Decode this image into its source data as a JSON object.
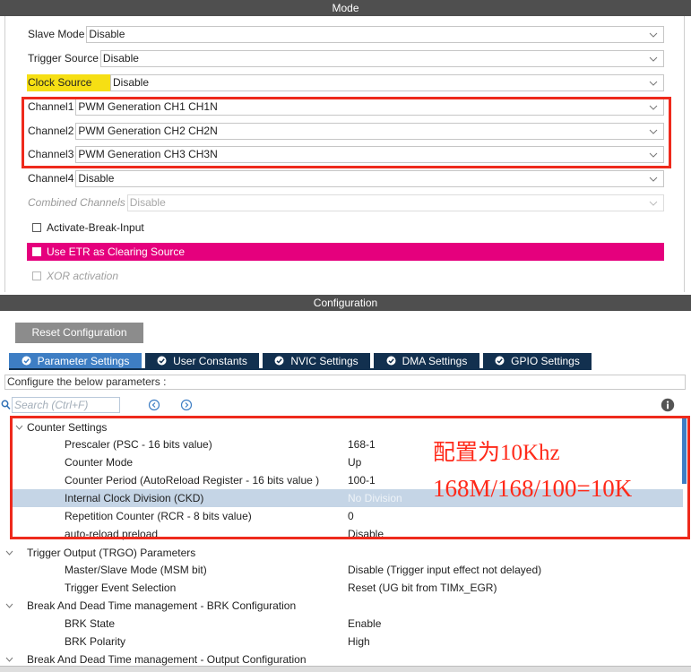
{
  "mode": {
    "header": "Mode",
    "slave_mode": {
      "label": "Slave Mode",
      "value": "Disable"
    },
    "trigger_source": {
      "label": "Trigger Source",
      "value": "Disable"
    },
    "clock_source": {
      "label": "Clock Source",
      "value": "Disable"
    },
    "channel1": {
      "label": "Channel1",
      "value": "PWM Generation CH1 CH1N"
    },
    "channel2": {
      "label": "Channel2",
      "value": "PWM Generation CH2 CH2N"
    },
    "channel3": {
      "label": "Channel3",
      "value": "PWM Generation CH3 CH3N"
    },
    "channel4": {
      "label": "Channel4",
      "value": "Disable"
    },
    "combined_channels": {
      "label": "Combined Channels",
      "value": "Disable",
      "disabled": true
    },
    "activate_break_input": {
      "label": "Activate-Break-Input",
      "checked": false
    },
    "use_etr": {
      "label": "Use ETR as Clearing Source",
      "checked": false
    },
    "xor_activation": {
      "label": "XOR activation",
      "checked": false,
      "disabled": true
    }
  },
  "configuration": {
    "header": "Configuration",
    "reset_button": "Reset Configuration",
    "tabs": [
      {
        "label": "Parameter Settings",
        "icon": "check-circle-icon",
        "active": true
      },
      {
        "label": "User Constants",
        "icon": "check-circle-icon",
        "active": false
      },
      {
        "label": "NVIC Settings",
        "icon": "check-circle-icon",
        "active": false
      },
      {
        "label": "DMA Settings",
        "icon": "check-circle-icon",
        "active": false
      },
      {
        "label": "GPIO Settings",
        "icon": "check-circle-icon",
        "active": false
      }
    ],
    "hint": "Configure the below parameters :",
    "search_placeholder": "Search (Ctrl+F)",
    "groups": [
      {
        "group": "Counter Settings",
        "params": [
          {
            "name": "Prescaler (PSC - 16 bits value)",
            "value": "168-1"
          },
          {
            "name": "Counter Mode",
            "value": "Up"
          },
          {
            "name": "Counter Period (AutoReload Register - 16 bits value )",
            "value": "100-1"
          },
          {
            "name": "Internal Clock Division (CKD)",
            "value": "No Division",
            "selected": true
          },
          {
            "name": "Repetition Counter (RCR - 8 bits value)",
            "value": "0"
          },
          {
            "name": "auto-reload preload",
            "value": "Disable"
          }
        ]
      },
      {
        "group": "Trigger Output (TRGO) Parameters",
        "params": [
          {
            "name": "Master/Slave Mode (MSM bit)",
            "value": "Disable (Trigger input effect not delayed)"
          },
          {
            "name": "Trigger Event Selection",
            "value": "Reset (UG bit from TIMx_EGR)"
          }
        ]
      },
      {
        "group": "Break And Dead Time management - BRK Configuration",
        "params": [
          {
            "name": "BRK State",
            "value": "Enable"
          },
          {
            "name": "BRK Polarity",
            "value": "High"
          }
        ]
      },
      {
        "group": "Break And Dead Time management - Output Configuration",
        "params": []
      }
    ]
  },
  "annotation": {
    "line1": "配置为10Khz",
    "line2": "168M/168/100=10K"
  },
  "colors": {
    "header_bg": "#4f4f4f",
    "highlight_yellow": "#f6df14",
    "etr_magenta": "#e5007d",
    "annotation_red": "#ee2a1c",
    "tab_active": "#3e7ec4",
    "tab_inactive": "#12304f",
    "selected_row": "#c5d5e6"
  }
}
